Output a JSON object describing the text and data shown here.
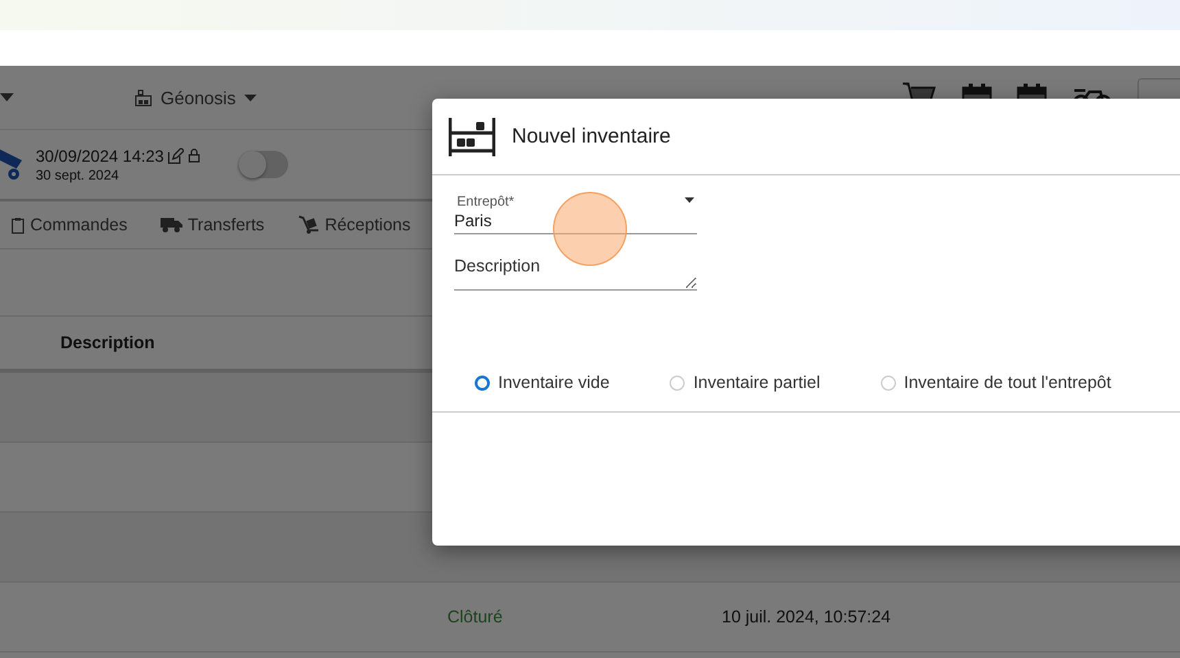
{
  "header": {
    "site_selector": "Géonosis"
  },
  "session": {
    "datetime": "30/09/2024 14:23",
    "date": "30 sept. 2024",
    "toggle": {
      "on": false
    }
  },
  "nav_tabs": [
    {
      "label": "Commandes",
      "kind": "clipboard"
    },
    {
      "label": "Transferts",
      "kind": "truck"
    },
    {
      "label": "Réceptions",
      "kind": "dolly"
    }
  ],
  "table": {
    "columns": [
      {
        "label": "Description"
      }
    ],
    "rows": [
      {
        "status": "Clôturé",
        "date": "10 juil. 2024, 10:57:24"
      }
    ]
  },
  "dialog": {
    "title": "Nouvel inventaire",
    "fields": [
      {
        "kind": "select",
        "label": "Entrepôt*",
        "value": "Paris"
      },
      {
        "kind": "textarea",
        "placeholder": "Description"
      }
    ],
    "options": [
      {
        "label": "Inventaire vide",
        "selected": true
      },
      {
        "label": "Inventaire partiel",
        "selected": false
      },
      {
        "label": "Inventaire de tout l'entrepôt",
        "selected": false
      }
    ]
  }
}
